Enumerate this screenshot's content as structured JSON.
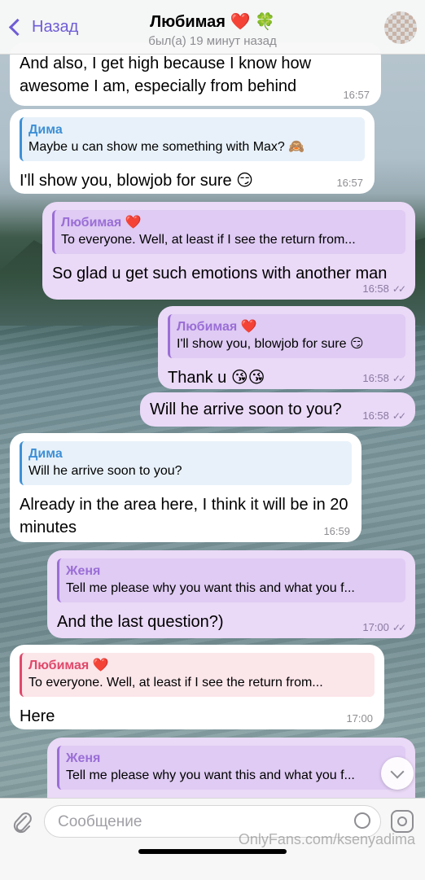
{
  "header": {
    "back_label": "Назад",
    "title": "Любимая",
    "title_emoji_1": "❤️",
    "title_emoji_2": "🍀",
    "status": "был(а) 19 минут назад"
  },
  "messages": [
    {
      "text": "And also, I get high because I know how awesome I am, especially from behind",
      "time": "16:57"
    },
    {
      "quote_name": "Дима",
      "quote_text": "Maybe u can show me something with Max? 🙈",
      "text": "I'll show you, blowjob for sure 😏",
      "time": "16:57"
    },
    {
      "quote_name": "Любимая ❤️",
      "quote_text": "To everyone. Well, at least if I see the return from...",
      "text": "So glad u get such emotions with another man",
      "time": "16:58"
    },
    {
      "quote_name": "Любимая ❤️",
      "quote_text": "I'll show you, blowjob for sure 😏",
      "text": "Thank u 😘😘",
      "time": "16:58"
    },
    {
      "text": "Will he arrive soon to you?",
      "time": "16:58"
    },
    {
      "quote_name": "Дима",
      "quote_text": "Will he arrive soon to you?",
      "text": "Already in the area here, I think it will be in 20 minutes",
      "time": "16:59"
    },
    {
      "quote_name": "Женя",
      "quote_text": "Tell me please why you want this and what you f...",
      "text": "And the last question?)",
      "time": "17:00"
    },
    {
      "quote_name": "Любимая ❤️",
      "quote_text": "To everyone. Well, at least if I see the return from...",
      "text": "Here",
      "time": "17:00"
    },
    {
      "quote_name": "Женя",
      "quote_text": "Tell me please why you want this and what you f..."
    }
  ],
  "input": {
    "placeholder": "Сообщение"
  },
  "watermark": "OnlyFans.com/ksenyadima",
  "icons": [
    "back-chevron-icon",
    "avatar",
    "scroll-down-icon",
    "attach-icon",
    "sticker-icon",
    "camera-icon"
  ],
  "colors": {
    "accent": "#6f5dd6",
    "outgoing_bubble": "#ead9f7",
    "incoming_bubble": "#ffffff"
  }
}
